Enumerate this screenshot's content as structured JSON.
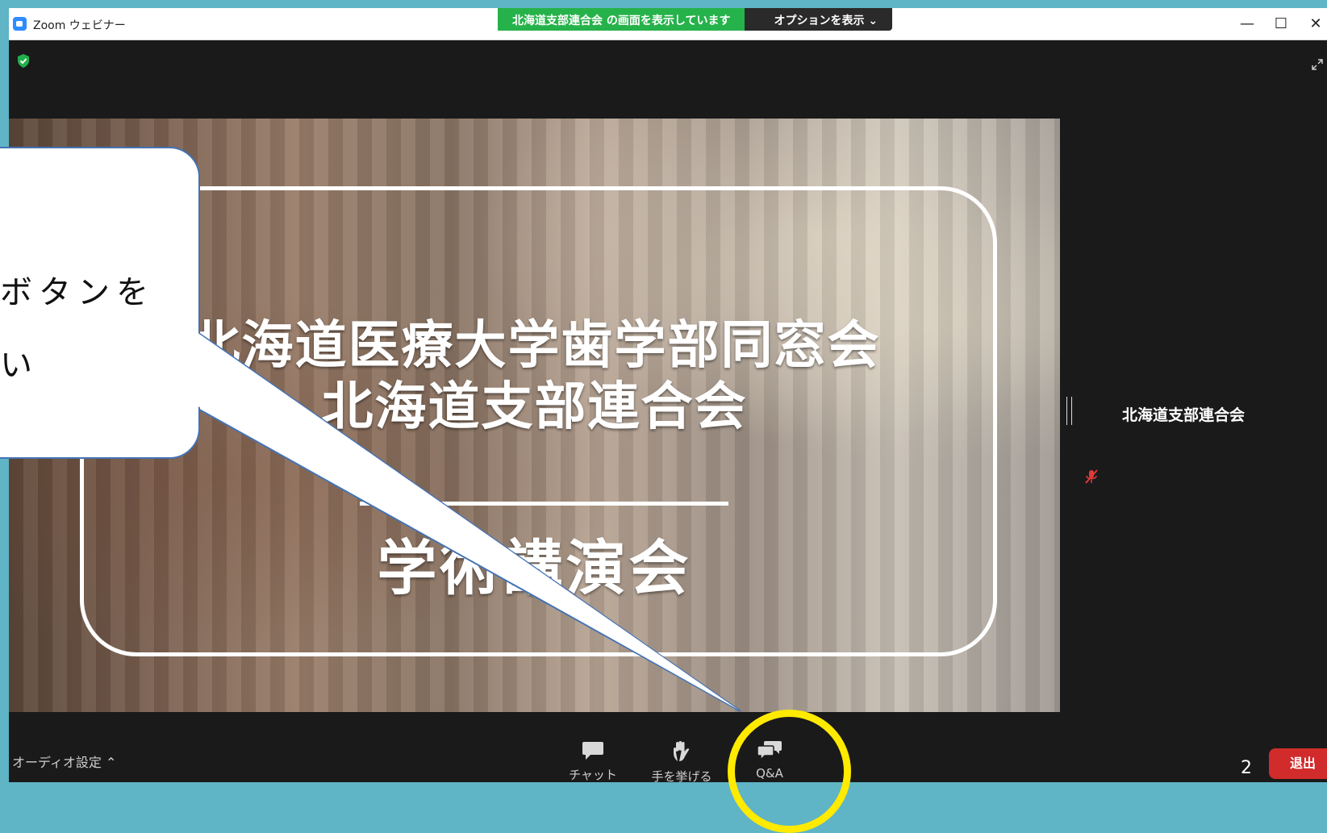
{
  "window": {
    "app_title": "Zoom ウェビナー",
    "controls": {
      "minimize": "—",
      "maximize": "☐",
      "close": "✕"
    }
  },
  "share_banner": {
    "status": "北海道支部連合会 の画面を表示しています",
    "options": "オプションを表示 ⌄"
  },
  "slide": {
    "line1": "北海道医療大学歯学部同窓会",
    "line2": "北海道支部連合会",
    "line3": "学術講演会"
  },
  "participant": {
    "name": "北海道支部連合会"
  },
  "toolbar": {
    "audio_settings": "オーディオ設定 ⌃",
    "chat": "チャット",
    "raise_hand": "手を挙げる",
    "qa": "Q&A",
    "participant_count": "2",
    "leave": "退出"
  },
  "callout": {
    "line1": "ボタンを",
    "line2": "い"
  },
  "colors": {
    "share_green": "#26b24a",
    "leave_red": "#d12b2b",
    "highlight_yellow": "#ffea00",
    "callout_border": "#4473b4",
    "outer_background": "#5fb4c6"
  },
  "icons": [
    "zoom-app-icon",
    "shield-icon",
    "fullscreen-icon",
    "muted-mic-icon",
    "chat-icon",
    "raise-hand-icon",
    "qa-icon"
  ]
}
